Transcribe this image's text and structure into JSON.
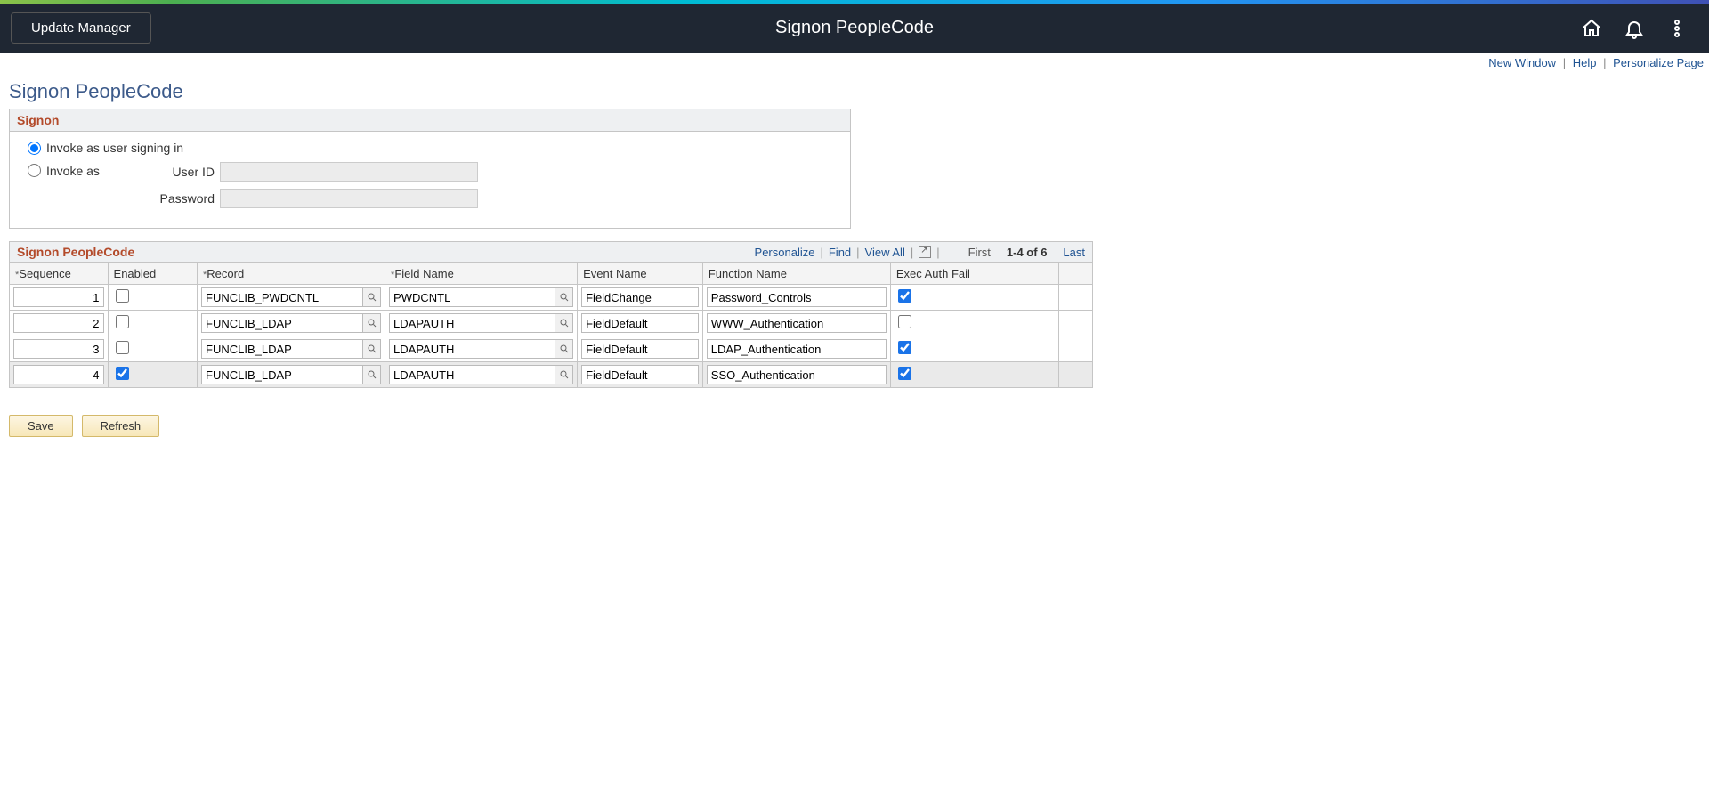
{
  "header": {
    "breadcrumb_button": "Update Manager",
    "title": "Signon PeopleCode"
  },
  "top_links": {
    "new_window": "New Window",
    "help": "Help",
    "personalize": "Personalize Page"
  },
  "page": {
    "title": "Signon PeopleCode"
  },
  "signon_box": {
    "title": "Signon",
    "radio1_label": "Invoke as user signing in",
    "radio2_label": "Invoke as",
    "user_id_label": "User ID",
    "password_label": "Password",
    "radio_selected": "signing_in",
    "user_id_value": "",
    "password_value": ""
  },
  "grid": {
    "title": "Signon PeopleCode",
    "nav": {
      "personalize": "Personalize",
      "find": "Find",
      "view_all": "View All",
      "first": "First",
      "range": "1-4 of 6",
      "last": "Last"
    },
    "columns": {
      "sequence": "Sequence",
      "enabled": "Enabled",
      "record": "Record",
      "field_name": "Field Name",
      "event_name": "Event Name",
      "function_name": "Function Name",
      "exec_auth_fail": "Exec Auth Fail"
    },
    "rows": [
      {
        "seq": "1",
        "enabled": false,
        "record": "FUNCLIB_PWDCNTL",
        "field": "PWDCNTL",
        "event": "FieldChange",
        "func": "Password_Controls",
        "exec": true
      },
      {
        "seq": "2",
        "enabled": false,
        "record": "FUNCLIB_LDAP",
        "field": "LDAPAUTH",
        "event": "FieldDefault",
        "func": "WWW_Authentication",
        "exec": false
      },
      {
        "seq": "3",
        "enabled": false,
        "record": "FUNCLIB_LDAP",
        "field": "LDAPAUTH",
        "event": "FieldDefault",
        "func": "LDAP_Authentication",
        "exec": true
      },
      {
        "seq": "4",
        "enabled": true,
        "record": "FUNCLIB_LDAP",
        "field": "LDAPAUTH",
        "event": "FieldDefault",
        "func": "SSO_Authentication",
        "exec": true
      }
    ]
  },
  "buttons": {
    "save": "Save",
    "refresh": "Refresh"
  }
}
